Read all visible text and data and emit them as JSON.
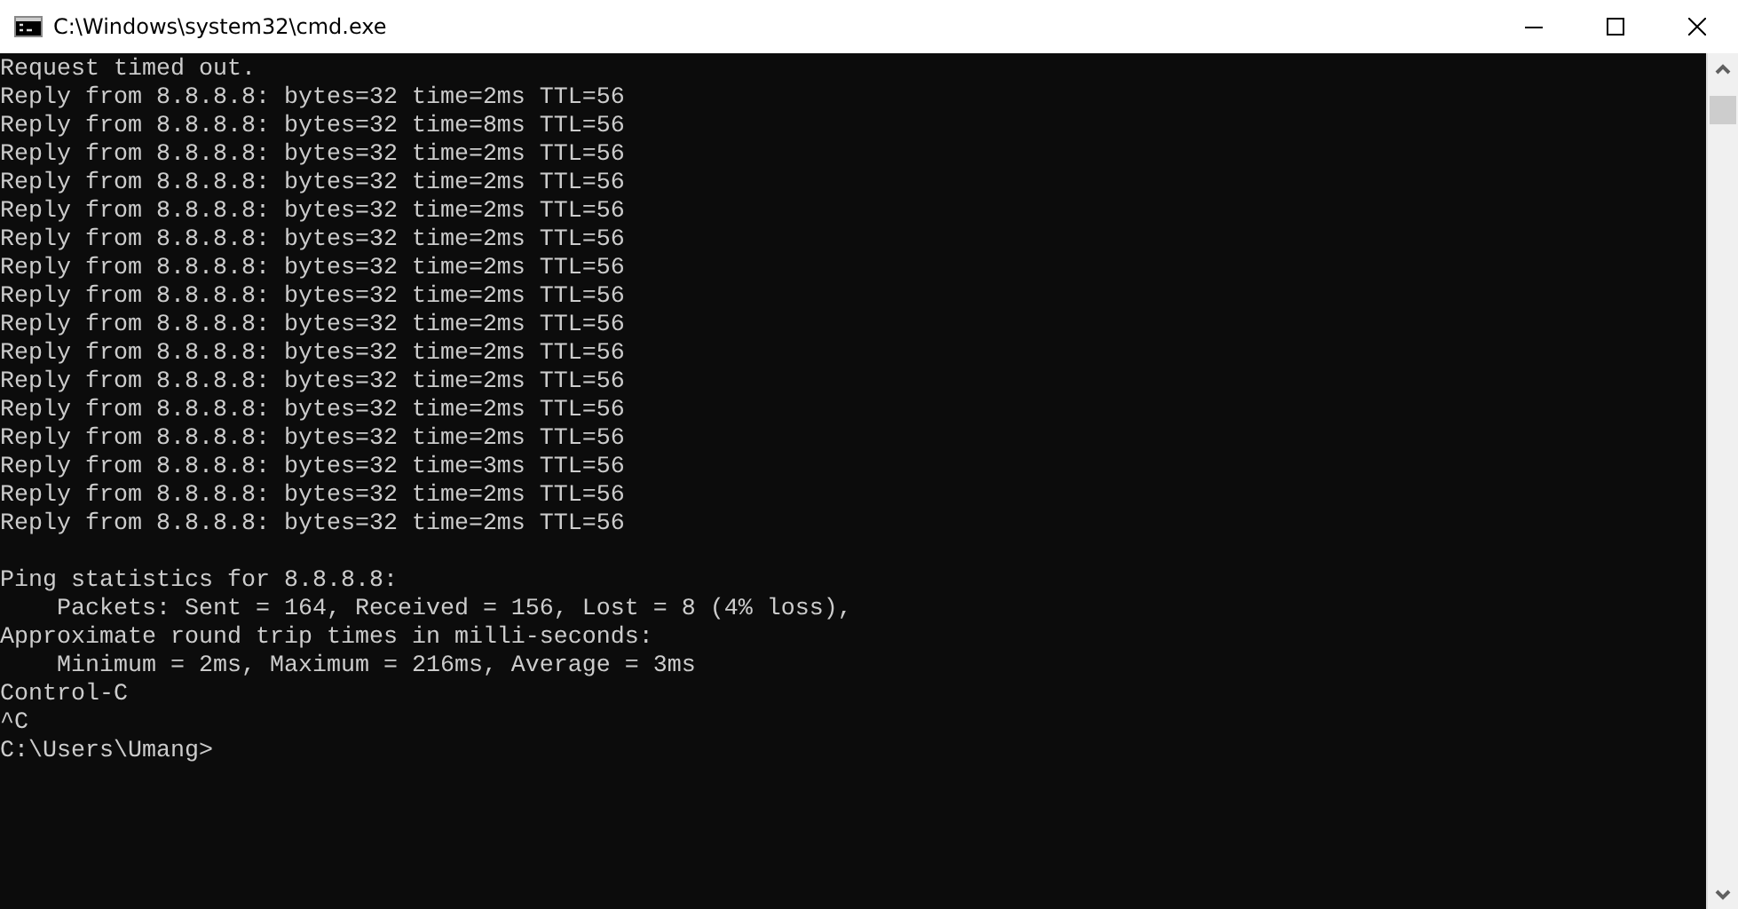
{
  "window": {
    "title": "C:\\Windows\\system32\\cmd.exe"
  },
  "console": {
    "blocks": [
      [
        "Request timed out.",
        "Reply from 8.8.8.8: bytes=32 time=2ms TTL=56",
        "Reply from 8.8.8.8: bytes=32 time=8ms TTL=56",
        "Reply from 8.8.8.8: bytes=32 time=2ms TTL=56",
        "Reply from 8.8.8.8: bytes=32 time=2ms TTL=56",
        "Reply from 8.8.8.8: bytes=32 time=2ms TTL=56",
        "Reply from 8.8.8.8: bytes=32 time=2ms TTL=56",
        "Reply from 8.8.8.8: bytes=32 time=2ms TTL=56",
        "Reply from 8.8.8.8: bytes=32 time=2ms TTL=56",
        "Reply from 8.8.8.8: bytes=32 time=2ms TTL=56",
        "Reply from 8.8.8.8: bytes=32 time=2ms TTL=56",
        "Reply from 8.8.8.8: bytes=32 time=2ms TTL=56",
        "Reply from 8.8.8.8: bytes=32 time=2ms TTL=56",
        "Reply from 8.8.8.8: bytes=32 time=2ms TTL=56",
        "Reply from 8.8.8.8: bytes=32 time=3ms TTL=56",
        "Reply from 8.8.8.8: bytes=32 time=2ms TTL=56",
        "Reply from 8.8.8.8: bytes=32 time=2ms TTL=56"
      ],
      [
        "Ping statistics for 8.8.8.8:",
        "    Packets: Sent = 164, Received = 156, Lost = 8 (4% loss),",
        "Approximate round trip times in milli-seconds:",
        "    Minimum = 2ms, Maximum = 216ms, Average = 3ms",
        "Control-C",
        "^C",
        "C:\\Users\\Umang>"
      ]
    ]
  }
}
